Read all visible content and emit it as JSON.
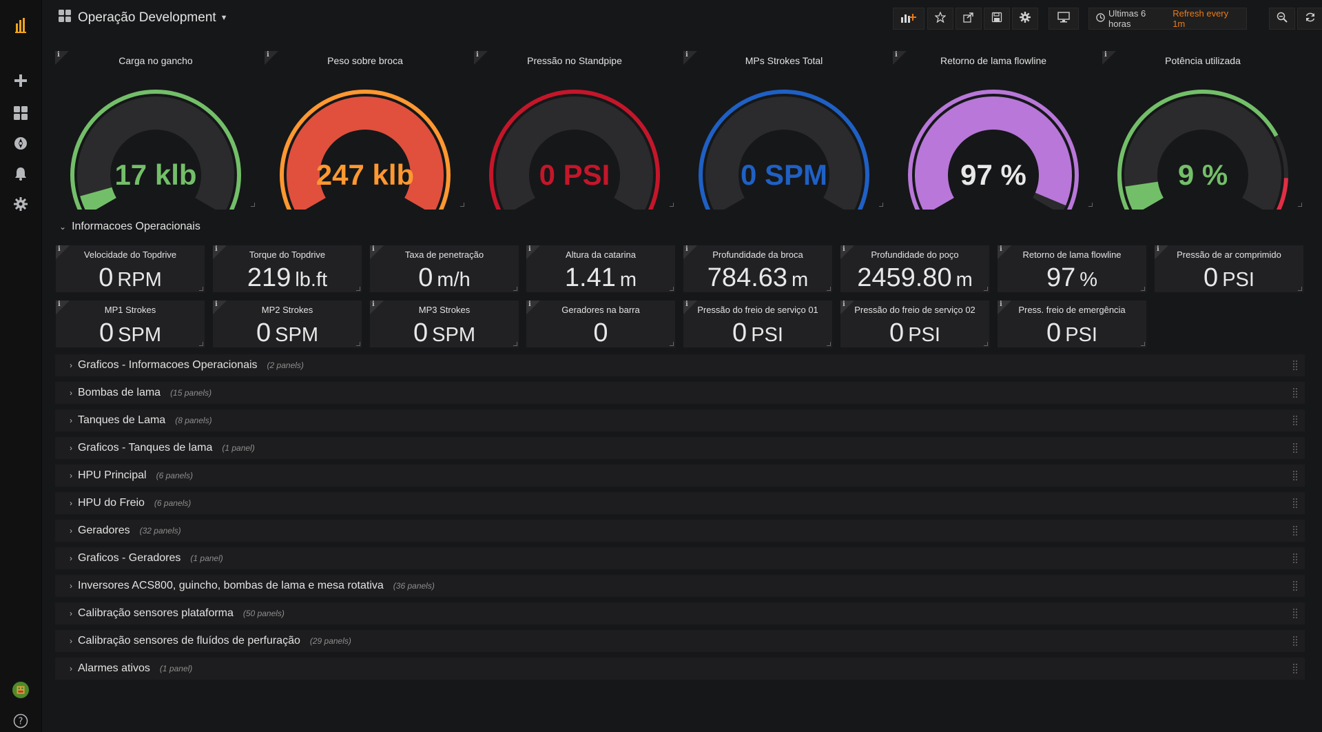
{
  "dashboard": {
    "title": "Operação Development"
  },
  "toolbar": {
    "time_range": "Ultimas 6 horas",
    "refresh": "Refresh every 1m"
  },
  "colors": {
    "green": "#73bf69",
    "orange": "#ff9830",
    "red": "#c4162a",
    "blue": "#1f60c4",
    "purple": "#b877d9",
    "accent": "#eb7b18"
  },
  "gauges": [
    {
      "title": "Carga no gancho",
      "value": "17 klb",
      "fraction": 0.06,
      "color": "#73bf69",
      "text_color": "#73bf69",
      "fill_color": "#73bf69"
    },
    {
      "title": "Peso sobre broca",
      "value": "247 klb",
      "fraction": 1.0,
      "color": "#ff9830",
      "text_color": "#ff9830",
      "fill_color": "#e0503d"
    },
    {
      "title": "Pressão no Standpipe",
      "value": "0 PSI",
      "fraction": 0.0,
      "color": "#c4162a",
      "text_color": "#c4162a",
      "fill_color": "#c4162a"
    },
    {
      "title": "MPs Strokes Total",
      "value": "0 SPM",
      "fraction": 0.0,
      "color": "#1f60c4",
      "text_color": "#1f60c4",
      "fill_color": "#1f60c4"
    },
    {
      "title": "Retorno de lama flowline",
      "value": "97 %",
      "fraction": 0.97,
      "color": "#b877d9",
      "text_color": "#e8e8e8",
      "fill_color": "#b877d9"
    },
    {
      "title": "Potência utilizada",
      "value": "9 %",
      "fraction": 0.09,
      "color": "#73bf69",
      "text_color": "#73bf69",
      "fill_color": "#73bf69"
    }
  ],
  "section": {
    "title": "Informacoes Operacionais"
  },
  "stats": [
    {
      "title": "Velocidade do Topdrive",
      "num": "0",
      "unit": "RPM"
    },
    {
      "title": "Torque do Topdrive",
      "num": "219",
      "unit": "lb.ft"
    },
    {
      "title": "Taxa de penetração",
      "num": "0",
      "unit": "m/h"
    },
    {
      "title": "Altura da catarina",
      "num": "1.41",
      "unit": "m"
    },
    {
      "title": "Profundidade da broca",
      "num": "784.63",
      "unit": "m"
    },
    {
      "title": "Profundidade do poço",
      "num": "2459.80",
      "unit": "m"
    },
    {
      "title": "Retorno de lama flowline",
      "num": "97",
      "unit": "%"
    },
    {
      "title": "Pressão de ar comprimido",
      "num": "0",
      "unit": "PSI"
    },
    {
      "title": "MP1 Strokes",
      "num": "0",
      "unit": "SPM"
    },
    {
      "title": "MP2 Strokes",
      "num": "0",
      "unit": "SPM"
    },
    {
      "title": "MP3 Strokes",
      "num": "0",
      "unit": "SPM"
    },
    {
      "title": "Geradores na barra",
      "num": "0",
      "unit": ""
    },
    {
      "title": "Pressão do freio de serviço 01",
      "num": "0",
      "unit": "PSI"
    },
    {
      "title": "Pressão do freio de serviço 02",
      "num": "0",
      "unit": "PSI"
    },
    {
      "title": "Press. freio de emergência",
      "num": "0",
      "unit": "PSI"
    }
  ],
  "rows": [
    {
      "title": "Graficos - Informacoes Operacionais",
      "count": "(2 panels)"
    },
    {
      "title": "Bombas de lama",
      "count": "(15 panels)"
    },
    {
      "title": "Tanques de Lama",
      "count": "(8 panels)"
    },
    {
      "title": "Graficos - Tanques de lama",
      "count": "(1 panel)"
    },
    {
      "title": "HPU Principal",
      "count": "(6 panels)"
    },
    {
      "title": "HPU do Freio",
      "count": "(6 panels)"
    },
    {
      "title": "Geradores",
      "count": "(32 panels)"
    },
    {
      "title": "Graficos - Geradores",
      "count": "(1 panel)"
    },
    {
      "title": "Inversores ACS800, guincho, bombas de lama e mesa rotativa",
      "count": "(36 panels)"
    },
    {
      "title": "Calibração sensores plataforma",
      "count": "(50 panels)"
    },
    {
      "title": "Calibração sensores de fluídos de perfuração",
      "count": "(29 panels)"
    },
    {
      "title": "Alarmes ativos",
      "count": "(1 panel)"
    }
  ],
  "icons": {
    "sidebar": [
      "grafana-logo-icon",
      "plus-icon",
      "dashboards-icon",
      "explore-icon",
      "alerting-bell-icon",
      "settings-gear-icon",
      "user-avatar",
      "help-icon"
    ],
    "toolbar": [
      "add-panel-icon",
      "star-icon",
      "share-icon",
      "save-icon",
      "gear-icon",
      "tv-monitor-icon",
      "clock-icon",
      "zoom-out-icon",
      "refresh-icon"
    ]
  }
}
